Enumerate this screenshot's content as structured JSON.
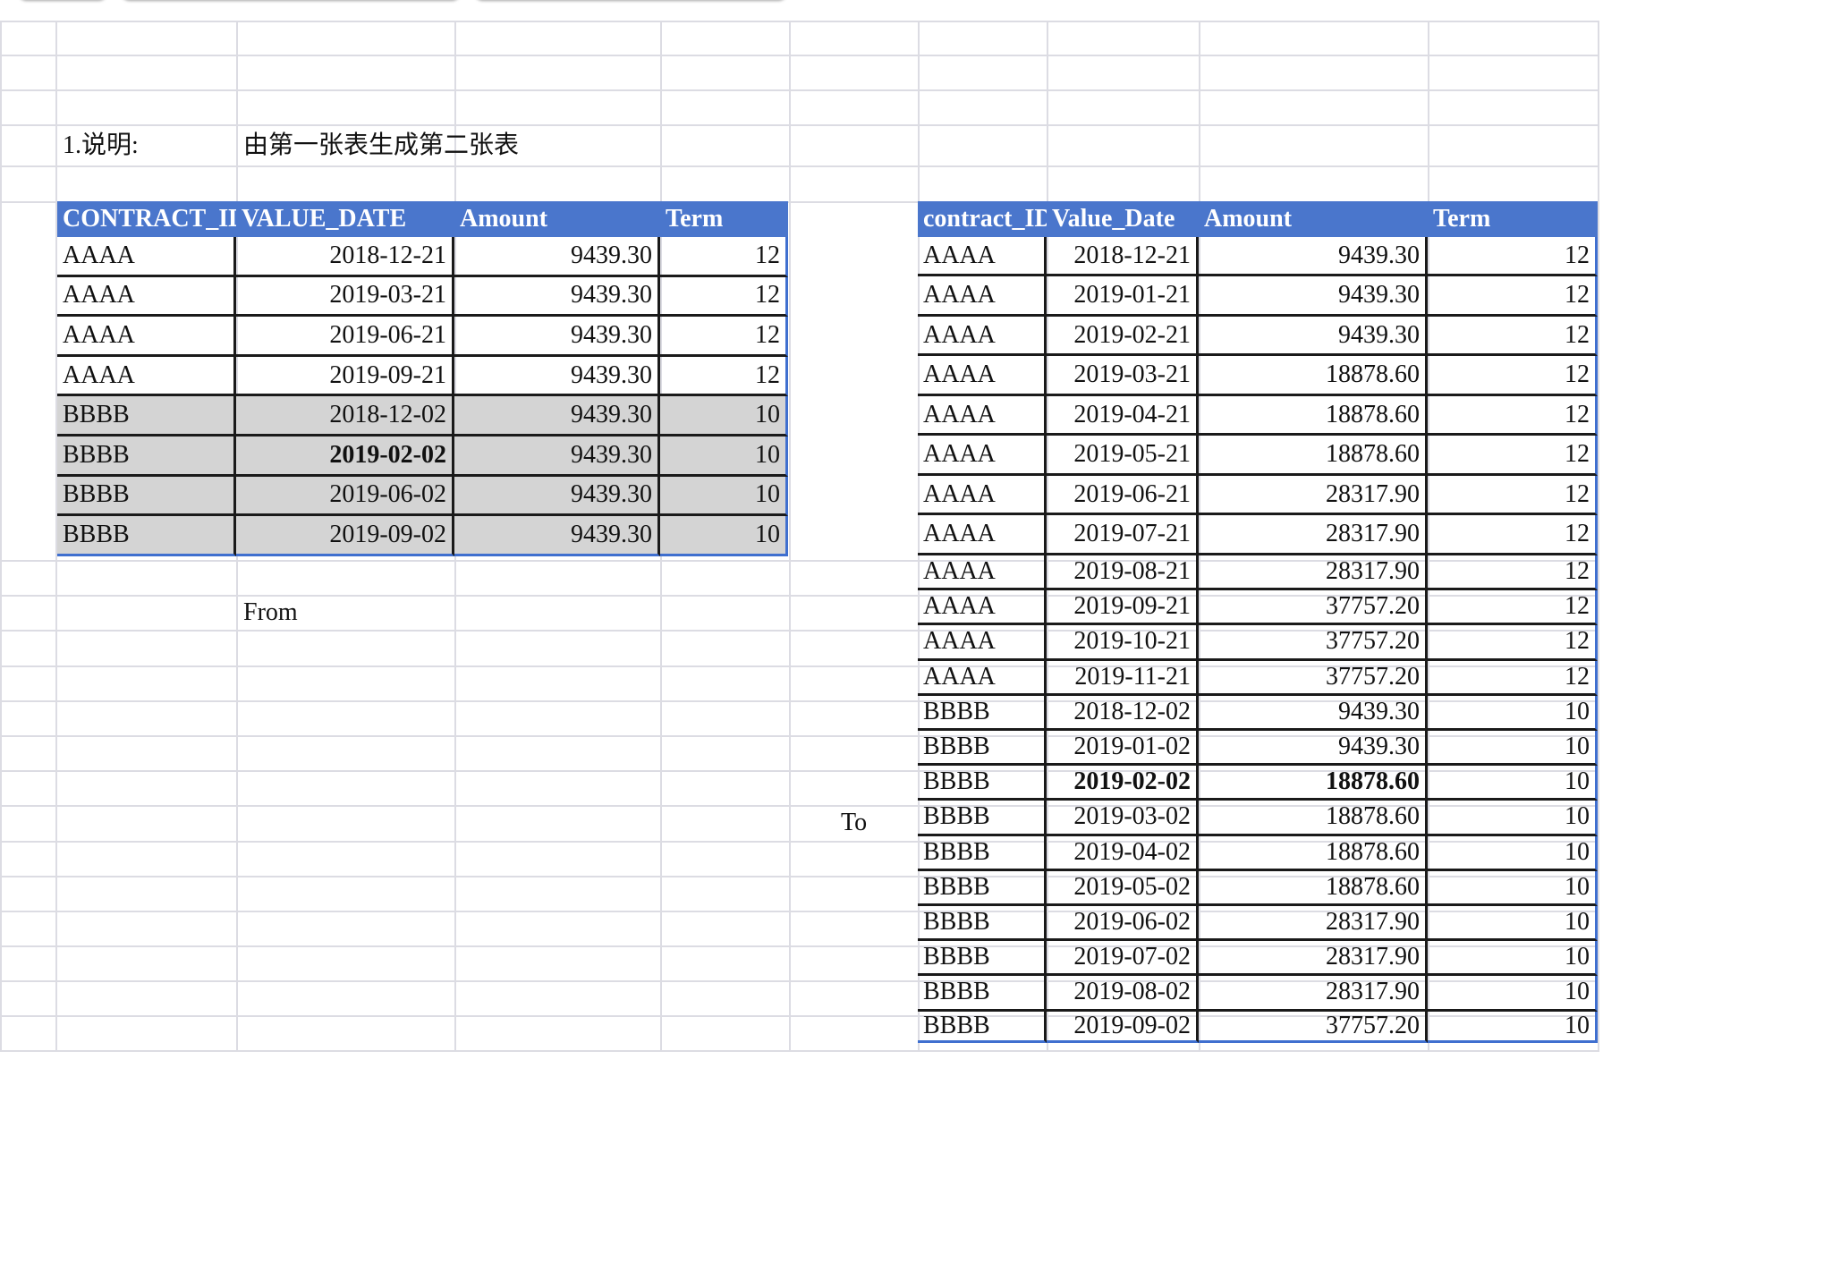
{
  "labels": {
    "desc_label": "1.说明:",
    "desc_text": "由第一张表生成第二张表",
    "from": "From",
    "to": "To"
  },
  "colors": {
    "header_bg": "#4a76cc",
    "header_text": "#ffffff",
    "highlight_row": "#d4d4d4",
    "grid_line": "#dcdce3",
    "cell_border": "#1a1a1a"
  },
  "left_table": {
    "headers": [
      "CONTRACT_ID",
      "VALUE_DATE",
      "Amount",
      "Term"
    ],
    "rows": [
      {
        "id": "AAAA",
        "date": "2018-12-21",
        "amount": "9439.30",
        "term": "12",
        "gray": false,
        "bold_date": false
      },
      {
        "id": "AAAA",
        "date": "2019-03-21",
        "amount": "9439.30",
        "term": "12",
        "gray": false,
        "bold_date": false
      },
      {
        "id": "AAAA",
        "date": "2019-06-21",
        "amount": "9439.30",
        "term": "12",
        "gray": false,
        "bold_date": false
      },
      {
        "id": "AAAA",
        "date": "2019-09-21",
        "amount": "9439.30",
        "term": "12",
        "gray": false,
        "bold_date": false
      },
      {
        "id": "BBBB",
        "date": "2018-12-02",
        "amount": "9439.30",
        "term": "10",
        "gray": true,
        "bold_date": false
      },
      {
        "id": "BBBB",
        "date": "2019-02-02",
        "amount": "9439.30",
        "term": "10",
        "gray": true,
        "bold_date": true
      },
      {
        "id": "BBBB",
        "date": "2019-06-02",
        "amount": "9439.30",
        "term": "10",
        "gray": true,
        "bold_date": false
      },
      {
        "id": "BBBB",
        "date": "2019-09-02",
        "amount": "9439.30",
        "term": "10",
        "gray": true,
        "bold_date": false
      }
    ]
  },
  "right_table": {
    "headers": [
      "contract_ID",
      "Value_Date",
      "Amount",
      "Term"
    ],
    "rows": [
      {
        "id": "AAAA",
        "date": "2018-12-21",
        "amount": "9439.30",
        "term": "12"
      },
      {
        "id": "AAAA",
        "date": "2019-01-21",
        "amount": "9439.30",
        "term": "12"
      },
      {
        "id": "AAAA",
        "date": "2019-02-21",
        "amount": "9439.30",
        "term": "12"
      },
      {
        "id": "AAAA",
        "date": "2019-03-21",
        "amount": "18878.60",
        "term": "12"
      },
      {
        "id": "AAAA",
        "date": "2019-04-21",
        "amount": "18878.60",
        "term": "12"
      },
      {
        "id": "AAAA",
        "date": "2019-05-21",
        "amount": "18878.60",
        "term": "12"
      },
      {
        "id": "AAAA",
        "date": "2019-06-21",
        "amount": "28317.90",
        "term": "12"
      },
      {
        "id": "AAAA",
        "date": "2019-07-21",
        "amount": "28317.90",
        "term": "12"
      },
      {
        "id": "AAAA",
        "date": "2019-08-21",
        "amount": "28317.90",
        "term": "12"
      },
      {
        "id": "AAAA",
        "date": "2019-09-21",
        "amount": "37757.20",
        "term": "12"
      },
      {
        "id": "AAAA",
        "date": "2019-10-21",
        "amount": "37757.20",
        "term": "12"
      },
      {
        "id": "AAAA",
        "date": "2019-11-21",
        "amount": "37757.20",
        "term": "12"
      },
      {
        "id": "BBBB",
        "date": "2018-12-02",
        "amount": "9439.30",
        "term": "10"
      },
      {
        "id": "BBBB",
        "date": "2019-01-02",
        "amount": "9439.30",
        "term": "10"
      },
      {
        "id": "BBBB",
        "date": "2019-02-02",
        "amount": "18878.60",
        "term": "10",
        "bold": true
      },
      {
        "id": "BBBB",
        "date": "2019-03-02",
        "amount": "18878.60",
        "term": "10"
      },
      {
        "id": "BBBB",
        "date": "2019-04-02",
        "amount": "18878.60",
        "term": "10"
      },
      {
        "id": "BBBB",
        "date": "2019-05-02",
        "amount": "18878.60",
        "term": "10"
      },
      {
        "id": "BBBB",
        "date": "2019-06-02",
        "amount": "28317.90",
        "term": "10"
      },
      {
        "id": "BBBB",
        "date": "2019-07-02",
        "amount": "28317.90",
        "term": "10"
      },
      {
        "id": "BBBB",
        "date": "2019-08-02",
        "amount": "28317.90",
        "term": "10"
      },
      {
        "id": "BBBB",
        "date": "2019-09-02",
        "amount": "37757.20",
        "term": "10"
      }
    ]
  }
}
